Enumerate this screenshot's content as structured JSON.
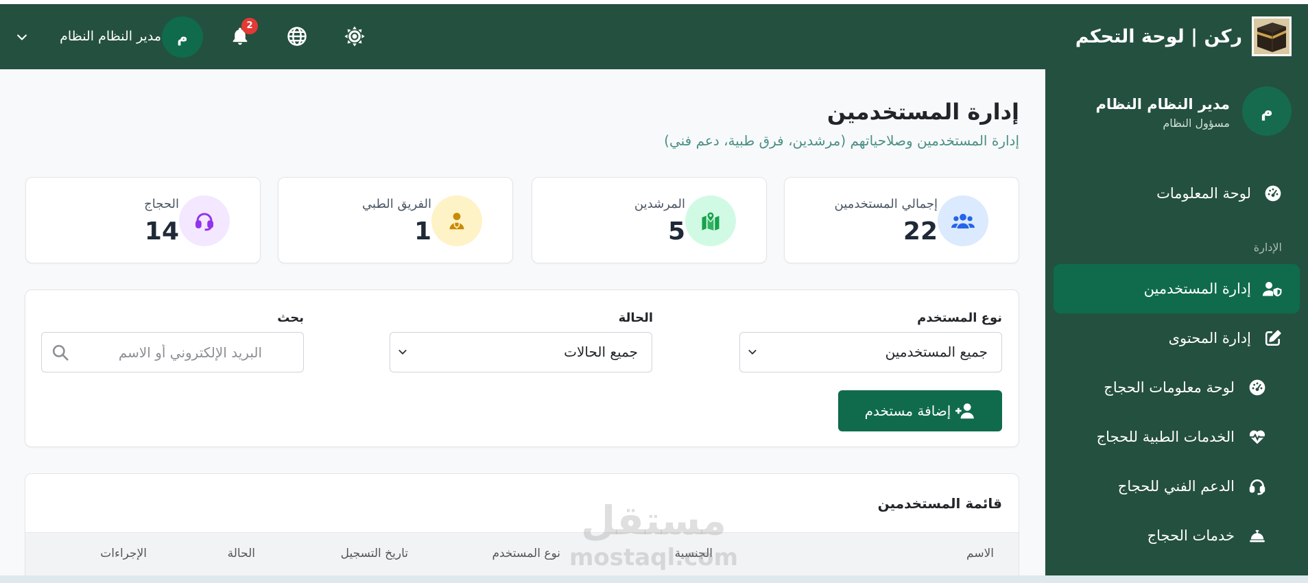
{
  "header": {
    "title": "ركن | لوحة التحكم",
    "user_name": "مدير النظام النظام",
    "user_initial": "م",
    "notification_count": "2"
  },
  "sidebar": {
    "profile": {
      "initial": "م",
      "name": "مدير النظام النظام",
      "role": "مسؤول النظام"
    },
    "section_label": "الإدارة",
    "items": [
      {
        "label": "لوحة المعلومات",
        "icon": "dashboard-icon",
        "active": false
      },
      {
        "label": "إدارة المستخدمين",
        "icon": "user-shield-icon",
        "active": true
      },
      {
        "label": "إدارة المحتوى",
        "icon": "edit-icon",
        "active": false
      },
      {
        "label": "لوحة معلومات الحجاج",
        "icon": "dashboard-icon",
        "active": false
      },
      {
        "label": "الخدمات الطبية للحجاج",
        "icon": "heartbeat-icon",
        "active": false
      },
      {
        "label": "الدعم الفني للحجاج",
        "icon": "headset-icon",
        "active": false
      },
      {
        "label": "خدمات الحجاج",
        "icon": "concierge-bell-icon",
        "active": false
      }
    ]
  },
  "page": {
    "title": "إدارة المستخدمين",
    "subtitle": "إدارة المستخدمين وصلاحياتهم (مرشدين، فرق طبية، دعم فني)"
  },
  "stats": [
    {
      "label": "إجمالي المستخدمين",
      "value": "22",
      "icon": "users-icon",
      "icon_color": "#2563eb",
      "icon_bg": "#dbeafe"
    },
    {
      "label": "المرشدين",
      "value": "5",
      "icon": "map-marked-icon",
      "icon_color": "#16a34a",
      "icon_bg": "#d1fae5"
    },
    {
      "label": "الفريق الطبي",
      "value": "1",
      "icon": "user-doctor-icon",
      "icon_color": "#ca8a04",
      "icon_bg": "#fef3c7"
    },
    {
      "label": "الحجاج",
      "value": "14",
      "icon": "headset-icon",
      "icon_color": "#9333ea",
      "icon_bg": "#f3e8ff"
    }
  ],
  "filters": {
    "user_type": {
      "label": "نوع المستخدم",
      "value": "جميع المستخدمين"
    },
    "status": {
      "label": "الحالة",
      "value": "جميع الحالات"
    },
    "search": {
      "label": "بحث",
      "placeholder": "البريد الإلكتروني أو الاسم"
    },
    "add_button_label": "إضافة مستخدم"
  },
  "users_table": {
    "title": "قائمة المستخدمين",
    "columns": [
      "الاسم",
      "الجنسية",
      "نوع المستخدم",
      "تاريخ التسجيل",
      "الحالة",
      "الإجراءات"
    ]
  },
  "watermark": {
    "arabic": "مستقل",
    "latin": "mostaql.com"
  },
  "colors": {
    "header_bg": "#24503f",
    "sidebar_bg": "#24503f",
    "active_item_bg": "#0f6b4c",
    "primary_button_bg": "#0f6b4c",
    "badge_bg": "#e53935",
    "subtitle": "#4a8f86",
    "page_bg": "#f8f9fa"
  }
}
